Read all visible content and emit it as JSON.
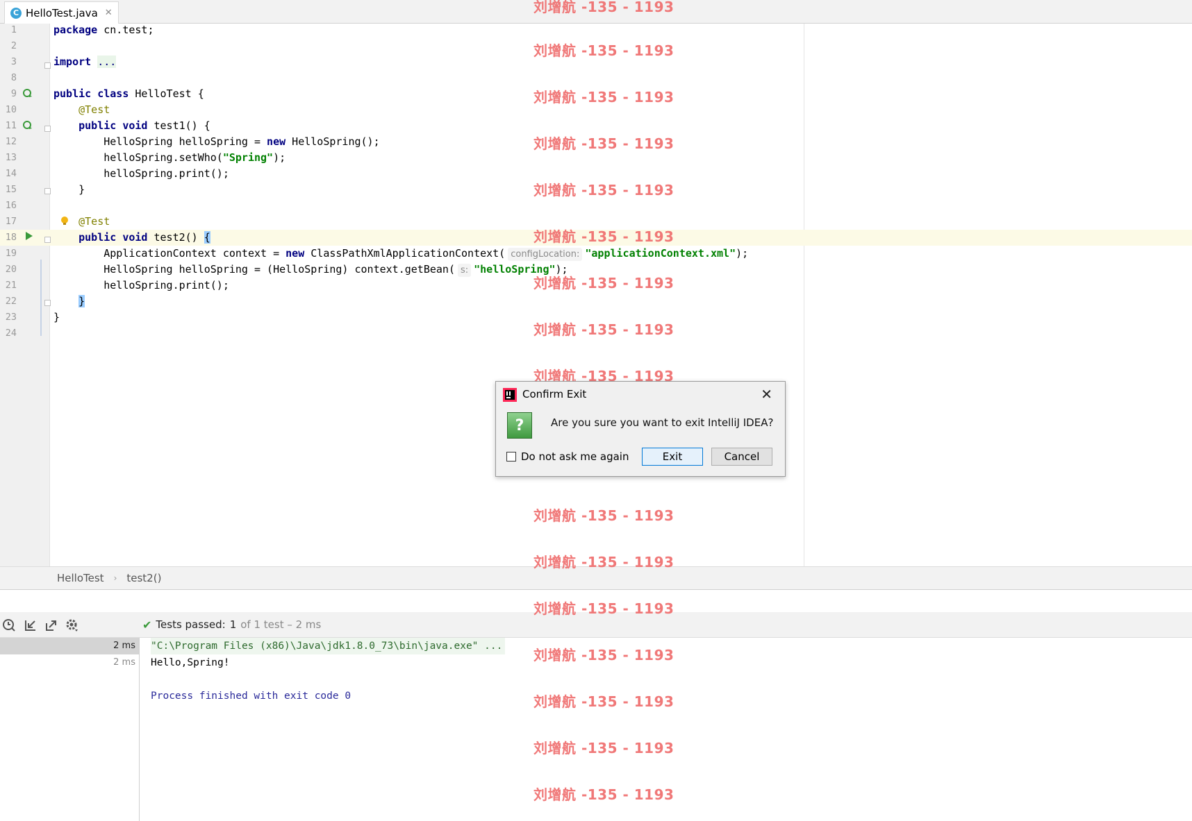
{
  "tab": {
    "filename": "HelloTest.java",
    "icon": "java-class-icon"
  },
  "editor": {
    "lines": [
      {
        "num": "1",
        "tokens": [
          {
            "t": "package",
            "c": "kw"
          },
          {
            "t": " cn.test;",
            "c": ""
          }
        ]
      },
      {
        "num": "2",
        "tokens": []
      },
      {
        "num": "3",
        "tokens": [
          {
            "t": "import",
            "c": "kw"
          },
          {
            "t": " ",
            "c": ""
          },
          {
            "t": "...",
            "c": "fold-dots"
          }
        ]
      },
      {
        "num": "8",
        "tokens": []
      },
      {
        "num": "9",
        "tokens": [
          {
            "t": "public class",
            "c": "kw"
          },
          {
            "t": " HelloTest {",
            "c": ""
          }
        ]
      },
      {
        "num": "10",
        "tokens": [
          {
            "t": "    ",
            "c": ""
          },
          {
            "t": "@Test",
            "c": "ann"
          }
        ]
      },
      {
        "num": "11",
        "tokens": [
          {
            "t": "    ",
            "c": ""
          },
          {
            "t": "public void",
            "c": "kw"
          },
          {
            "t": " test1() {",
            "c": ""
          }
        ]
      },
      {
        "num": "12",
        "tokens": [
          {
            "t": "        HelloSpring helloSpring = ",
            "c": ""
          },
          {
            "t": "new",
            "c": "kw"
          },
          {
            "t": " HelloSpring();",
            "c": ""
          }
        ]
      },
      {
        "num": "13",
        "tokens": [
          {
            "t": "        helloSpring.setWho(",
            "c": ""
          },
          {
            "t": "\"Spring\"",
            "c": "str"
          },
          {
            "t": ");",
            "c": ""
          }
        ]
      },
      {
        "num": "14",
        "tokens": [
          {
            "t": "        helloSpring.print();",
            "c": ""
          }
        ]
      },
      {
        "num": "15",
        "tokens": [
          {
            "t": "    }",
            "c": ""
          }
        ]
      },
      {
        "num": "16",
        "tokens": []
      },
      {
        "num": "17",
        "tokens": [
          {
            "t": "    ",
            "c": ""
          },
          {
            "t": "@Test",
            "c": "ann"
          }
        ]
      },
      {
        "num": "18",
        "tokens": [
          {
            "t": "    ",
            "c": ""
          },
          {
            "t": "public void",
            "c": "kw"
          },
          {
            "t": " test2() ",
            "c": ""
          },
          {
            "t": "{",
            "c": "brace-hl"
          }
        ],
        "current": true
      },
      {
        "num": "19",
        "tokens": [
          {
            "t": "        ApplicationContext context = ",
            "c": ""
          },
          {
            "t": "new",
            "c": "kw"
          },
          {
            "t": " ClassPathXmlApplicationContext(",
            "c": ""
          },
          {
            "t": "configLocation:",
            "c": "hint"
          },
          {
            "t": "\"applicationContext.xml\"",
            "c": "str"
          },
          {
            "t": ");",
            "c": ""
          }
        ]
      },
      {
        "num": "20",
        "tokens": [
          {
            "t": "        HelloSpring helloSpring = (HelloSpring) context.getBean(",
            "c": ""
          },
          {
            "t": "s:",
            "c": "hint"
          },
          {
            "t": "\"helloSpring\"",
            "c": "str"
          },
          {
            "t": ");",
            "c": ""
          }
        ]
      },
      {
        "num": "21",
        "tokens": [
          {
            "t": "        helloSpring.print();",
            "c": ""
          }
        ]
      },
      {
        "num": "22",
        "tokens": [
          {
            "t": "    ",
            "c": ""
          },
          {
            "t": "}",
            "c": "brace-hl"
          }
        ]
      },
      {
        "num": "23",
        "tokens": [
          {
            "t": "}",
            "c": ""
          }
        ]
      },
      {
        "num": "24",
        "tokens": []
      }
    ]
  },
  "breadcrumb": {
    "items": [
      "HelloTest",
      "test2()"
    ],
    "separator": "›"
  },
  "run": {
    "status_check": "✔",
    "status_label": "Tests passed:",
    "status_count": "1",
    "status_rest": "of 1 test – 2 ms",
    "tree": [
      {
        "duration": "2 ms"
      },
      {
        "duration": "2 ms"
      }
    ],
    "console": [
      "\"C:\\Program Files (x86)\\Java\\jdk1.8.0_73\\bin\\java.exe\" ...",
      "Hello,Spring!",
      "",
      "Process finished with exit code 0"
    ]
  },
  "watermark": "刘增航 -135 - 1193",
  "dialog": {
    "title": "Confirm Exit",
    "close": "✕",
    "icon_glyph": "?",
    "message": "Are you sure you want to exit IntelliJ IDEA?",
    "checkbox_label": "Do not ask me again",
    "exit_label": "Exit",
    "cancel_label": "Cancel"
  },
  "colors": {
    "keyword": "#000080",
    "annotation": "#808000",
    "string": "#008000",
    "watermark": "#ef6a6a"
  }
}
